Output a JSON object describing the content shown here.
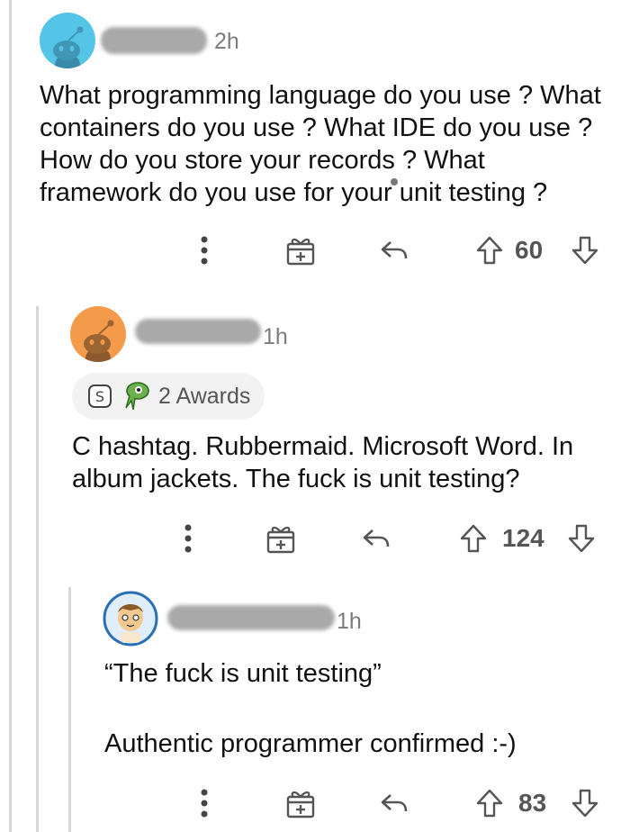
{
  "comments": [
    {
      "time": "2h",
      "body": "What programming language do you use ? What containers do you use ? What IDE do you use ? How do you store your records ? What framework do you use for your unit testing ?",
      "score": "60"
    },
    {
      "time": "1h",
      "awards": "2 Awards",
      "body": "C hashtag. Rubbermaid. Microsoft Word. In album jackets. The fuck is unit testing?",
      "score": "124"
    },
    {
      "time": "1h",
      "body_line1": "“The fuck is unit testing”",
      "body_line2": "Authentic programmer confirmed :-)",
      "score": "83"
    }
  ],
  "icons": {
    "more": "more-options-icon",
    "award": "give-award-icon",
    "reply": "reply-icon",
    "upvote": "upvote-icon",
    "downvote": "downvote-icon"
  },
  "colors": {
    "avatar1": "#54c5e6",
    "avatar2": "#f39a4b",
    "text": "#111111",
    "muted": "#7c7c7c"
  }
}
